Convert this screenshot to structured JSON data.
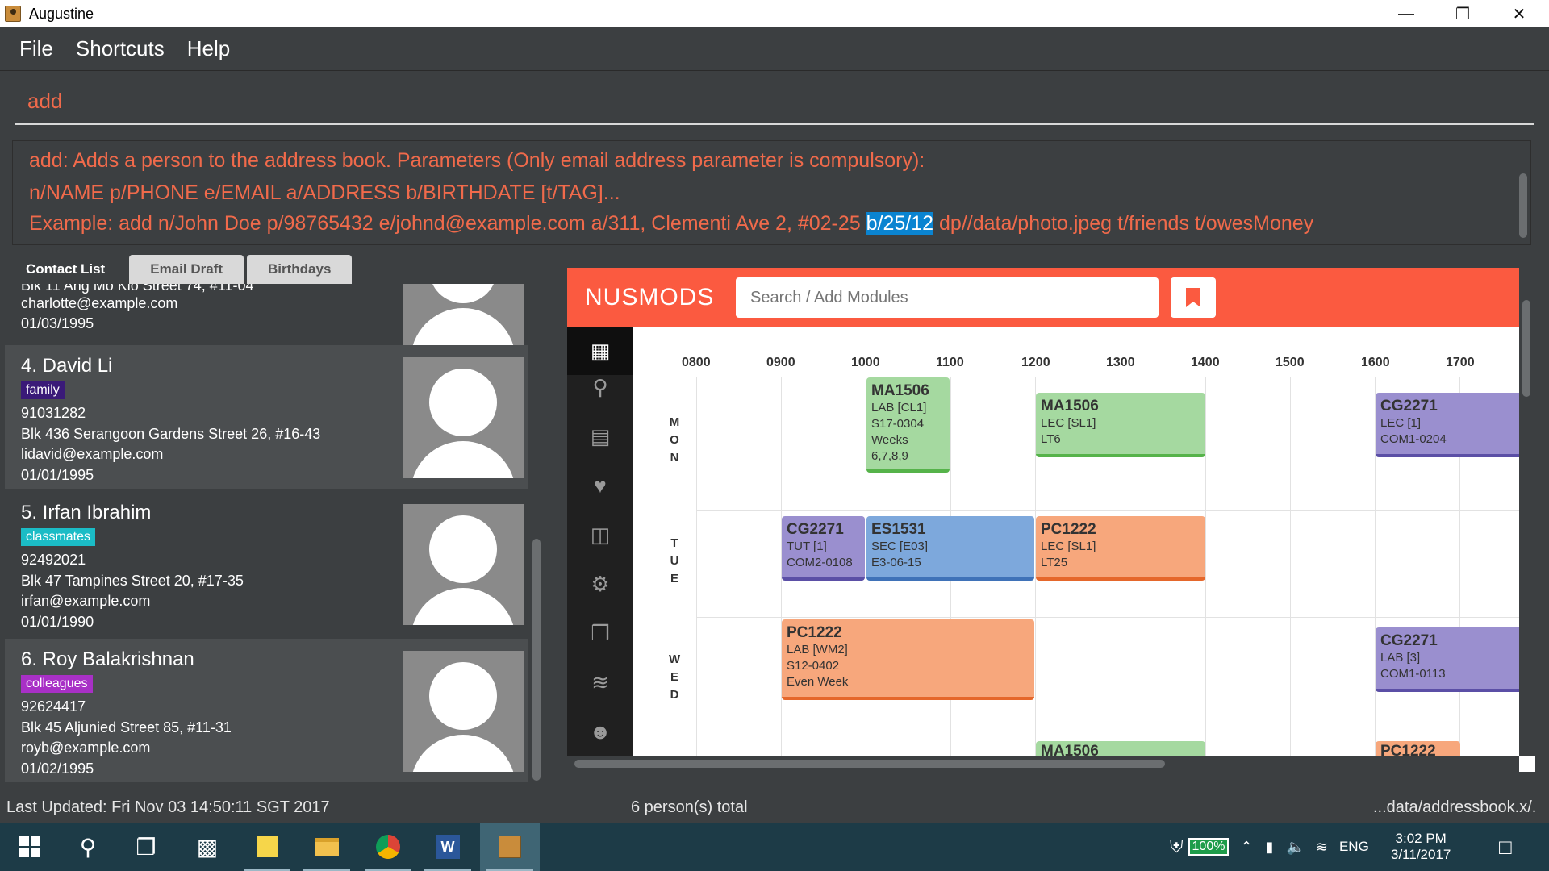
{
  "window": {
    "title": "Augustine",
    "controls": [
      "minimize",
      "restore",
      "close"
    ]
  },
  "menu": {
    "items": [
      "File",
      "Shortcuts",
      "Help"
    ]
  },
  "command_box": {
    "value": "add"
  },
  "result_box": {
    "line1": "add: Adds a person to the address book. Parameters (Only email address parameter is compulsory):",
    "line2": "n/NAME p/PHONE e/EMAIL a/ADDRESS b/BIRTHDATE [t/TAG]...",
    "line3_pre": "Example: add n/John Doe p/98765432 e/johnd@example.com a/311, Clementi Ave 2, #02-25 ",
    "line3_hl": "b/25/12",
    "line3_post": " dp//data/photo.jpeg t/friends t/owesMoney"
  },
  "tabs": [
    "Contact List",
    "Email Draft",
    "Birthdays"
  ],
  "contacts": {
    "partial": {
      "address": "Blk 11 Ang Mo Kio Street 74, #11-04",
      "email": "charlotte@example.com",
      "birthday": "01/03/1995"
    },
    "items": [
      {
        "name": "4.  David Li",
        "tag": "family",
        "tag_color": "#3a1a78",
        "phone": "91031282",
        "address": "Blk 436 Serangoon Gardens Street 26, #16-43",
        "email": "lidavid@example.com",
        "birthday": "01/01/1995"
      },
      {
        "name": "5.  Irfan Ibrahim",
        "tag": "classmates",
        "tag_color": "#1bbcc6",
        "phone": "92492021",
        "address": "Blk 47 Tampines Street 20, #17-35",
        "email": "irfan@example.com",
        "birthday": "01/01/1990"
      },
      {
        "name": "6.  Roy Balakrishnan",
        "tag": "colleagues",
        "tag_color": "#a830c6",
        "phone": "92624417",
        "address": "Blk 45 Aljunied Street 85, #11-31",
        "email": "royb@example.com",
        "birthday": "01/02/1995"
      }
    ]
  },
  "nusmods": {
    "logo": "NUSMODS",
    "search_placeholder": "Search / Add Modules",
    "accent": "#fb5a40",
    "sidebar_icons": [
      "timetable-icon",
      "search-icon",
      "building-icon",
      "heart-icon",
      "news-icon",
      "settings-icon",
      "cubes-icon",
      "rss-icon",
      "reddit-icon"
    ],
    "times": [
      "0800",
      "0900",
      "1000",
      "1100",
      "1200",
      "1300",
      "1400",
      "1500",
      "1600",
      "1700"
    ],
    "days": [
      {
        "label": "MON",
        "letters": [
          "M",
          "O",
          "N"
        ]
      },
      {
        "label": "TUE",
        "letters": [
          "T",
          "U",
          "E"
        ]
      },
      {
        "label": "WED",
        "letters": [
          "W",
          "E",
          "D"
        ]
      }
    ],
    "modules": [
      {
        "code": "MA1506",
        "lines": [
          "LAB [CL1]",
          "S17-0304",
          "Weeks",
          "6,7,8,9"
        ],
        "color": "green"
      },
      {
        "code": "MA1506",
        "lines": [
          "LEC [SL1]",
          "LT6"
        ],
        "color": "green"
      },
      {
        "code": "CG2271",
        "lines": [
          "LEC [1]",
          "COM1-0204"
        ],
        "color": "purple"
      },
      {
        "code": "CG2271",
        "lines": [
          "TUT [1]",
          "COM2-0108"
        ],
        "color": "purple"
      },
      {
        "code": "ES1531",
        "lines": [
          "SEC [E03]",
          "E3-06-15"
        ],
        "color": "blue"
      },
      {
        "code": "PC1222",
        "lines": [
          "LEC [SL1]",
          "LT25"
        ],
        "color": "orange"
      },
      {
        "code": "PC1222",
        "lines": [
          "LAB [WM2]",
          "S12-0402",
          "Even Week"
        ],
        "color": "orange"
      },
      {
        "code": "CG2271",
        "lines": [
          "LAB [3]",
          "COM1-0113"
        ],
        "color": "purple"
      },
      {
        "code": "MA1506",
        "lines": [],
        "color": "green"
      },
      {
        "code": "PC1222",
        "lines": [],
        "color": "orange"
      }
    ]
  },
  "status": {
    "last_updated": "Last Updated: Fri Nov 03 14:50:11 SGT 2017",
    "total": "6 person(s) total",
    "path": "...data/addressbook.x/."
  },
  "taskbar": {
    "battery": "100%",
    "lang": "ENG",
    "time": "3:02 PM",
    "date": "3/11/2017"
  }
}
